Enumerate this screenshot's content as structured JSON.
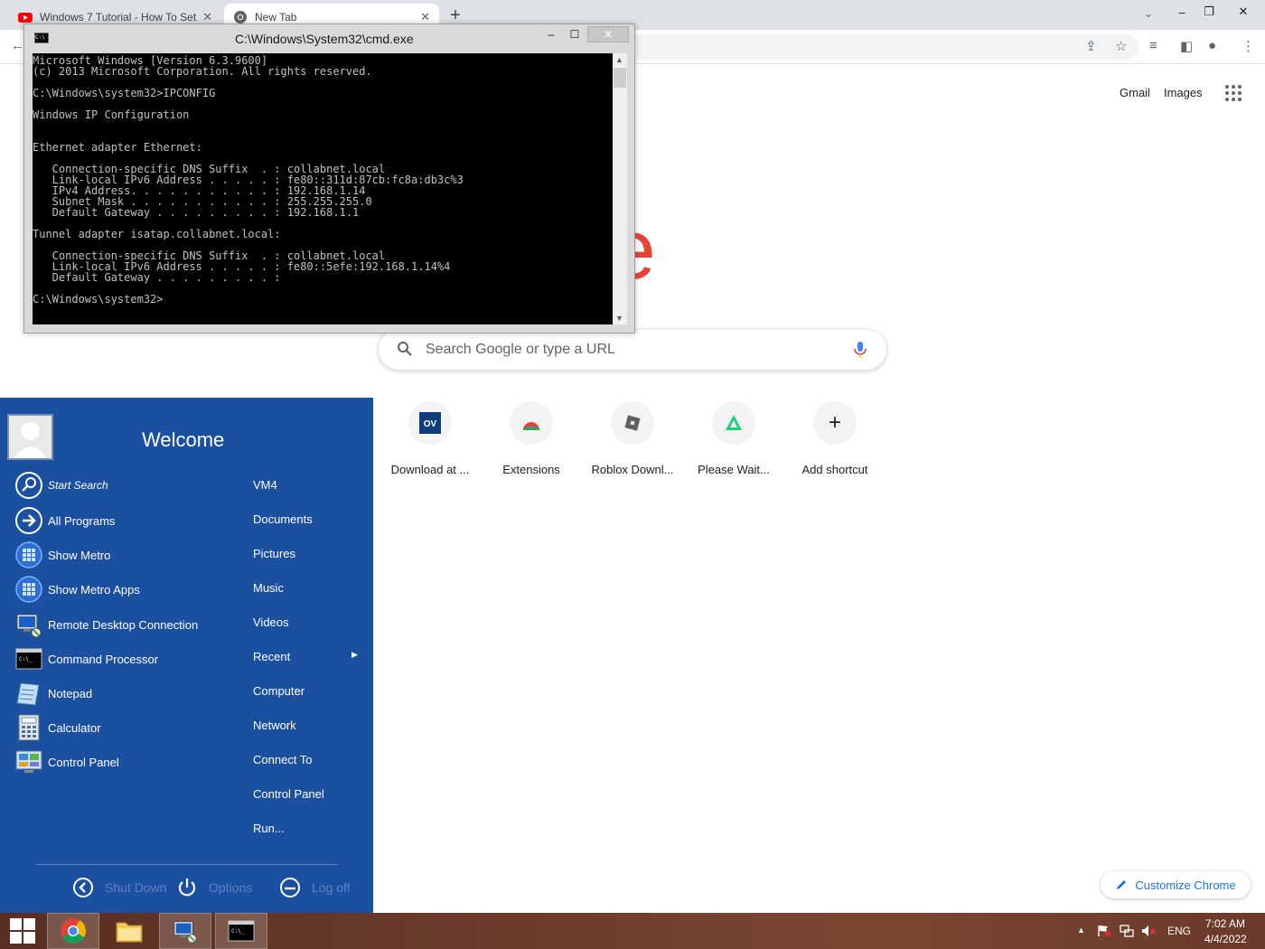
{
  "browser": {
    "tabs": [
      {
        "title": "Windows 7 Tutorial - How To Set",
        "icon": "youtube-icon",
        "active": false
      },
      {
        "title": "New Tab",
        "icon": "chrome-icon",
        "active": true
      }
    ],
    "newtab_symbol": "+",
    "top_links": {
      "gmail": "Gmail",
      "images": "Images"
    },
    "logo_text": "ogle",
    "search_placeholder": "Search Google or type a URL",
    "shortcuts": [
      {
        "label": "Download at ...",
        "icon": "ov-icon"
      },
      {
        "label": "Extensions",
        "icon": "chrome-webstore-icon"
      },
      {
        "label": "Roblox Downl...",
        "icon": "roblox-icon"
      },
      {
        "label": "Please Wait...",
        "icon": "apkpure-icon"
      },
      {
        "label": "Add shortcut",
        "icon": "plus-icon"
      }
    ],
    "customize_label": "Customize Chrome",
    "accent_color": "#1a73e8"
  },
  "cmd": {
    "title": "C:\\Windows\\System32\\cmd.exe",
    "console_lines": [
      "Microsoft Windows [Version 6.3.9600]",
      "(c) 2013 Microsoft Corporation. All rights reserved.",
      "",
      "C:\\Windows\\system32>IPCONFIG",
      "",
      "Windows IP Configuration",
      "",
      "",
      "Ethernet adapter Ethernet:",
      "",
      "   Connection-specific DNS Suffix  . : collabnet.local",
      "   Link-local IPv6 Address . . . . . : fe80::311d:87cb:fc8a:db3c%3",
      "   IPv4 Address. . . . . . . . . . . : 192.168.1.14",
      "   Subnet Mask . . . . . . . . . . . : 255.255.255.0",
      "   Default Gateway . . . . . . . . . : 192.168.1.1",
      "",
      "Tunnel adapter isatap.collabnet.local:",
      "",
      "   Connection-specific DNS Suffix  . : collabnet.local",
      "   Link-local IPv6 Address . . . . . : fe80::5efe:192.168.1.14%4",
      "   Default Gateway . . . . . . . . . :",
      "",
      "C:\\Windows\\system32>"
    ]
  },
  "startmenu": {
    "welcome": "Welcome",
    "left_items": [
      {
        "label": "Start Search",
        "icon": "search-icon"
      },
      {
        "label": "All Programs",
        "icon": "arrow-right-icon"
      },
      {
        "label": "Show Metro",
        "icon": "metro-icon"
      },
      {
        "label": "Show Metro Apps",
        "icon": "metro-apps-icon"
      },
      {
        "label": "Remote Desktop Connection",
        "icon": "remote-desktop-icon"
      },
      {
        "label": "Command Processor",
        "icon": "cmd-icon"
      },
      {
        "label": "Notepad",
        "icon": "notepad-icon"
      },
      {
        "label": "Calculator",
        "icon": "calculator-icon"
      },
      {
        "label": "Control Panel",
        "icon": "control-panel-icon"
      }
    ],
    "right_items": [
      "VM4",
      "Documents",
      "Pictures",
      "Music",
      "Videos",
      "Recent",
      "Computer",
      "Network",
      "Connect To",
      "Control Panel",
      "Run..."
    ],
    "bottom": {
      "shutdown": "Shut Down",
      "options": "Options",
      "logoff": "Log off"
    },
    "bg_color": "#1b4fa0"
  },
  "taskbar": {
    "apps": [
      {
        "name": "chrome",
        "icon": "chrome-icon"
      },
      {
        "name": "explorer",
        "icon": "folder-icon"
      },
      {
        "name": "remote-desktop",
        "icon": "remote-desktop-icon"
      },
      {
        "name": "cmd",
        "icon": "cmd-icon"
      }
    ],
    "language": "ENG",
    "time": "7:02 AM",
    "date": "4/4/2022"
  }
}
